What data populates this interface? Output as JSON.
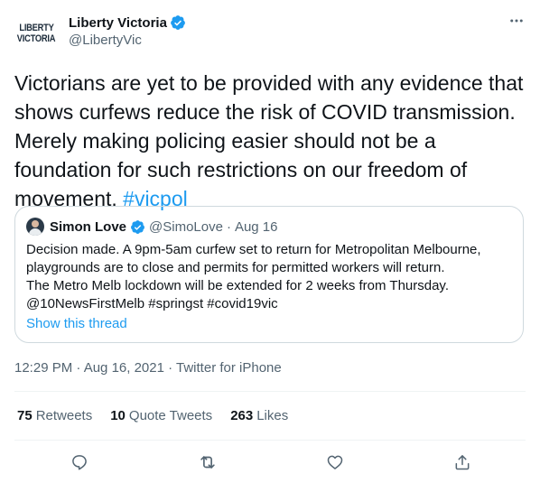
{
  "author": {
    "avatar_text_line1": "LIBERTY",
    "avatar_text_line2": "VICTORIA",
    "name": "Liberty Victoria",
    "handle": "@LibertyVic"
  },
  "tweet": {
    "text_part": "Victorians are yet to be provided with any evidence that shows curfews reduce the risk of COVID transmission. Merely making policing easier should not be a foundation for such restrictions on our freedom of movement.",
    "hashtag": "#vicpol",
    "meta": "12:29 PM · Aug 16, 2021 · Twitter for iPhone"
  },
  "quote": {
    "name": "Simon Love",
    "handle": "@SimoLove",
    "dot": "·",
    "date": "Aug 16",
    "line1": "Decision made. A 9pm-5am curfew set to return for Metropolitan Melbourne,",
    "line2": "playgrounds are to close and permits for permitted workers will return.",
    "line3": "The Metro Melb lockdown will be extended for 2 weeks from Thursday.",
    "line4": "@10NewsFirstMelb #springst #covid19vic",
    "show_thread": "Show this thread"
  },
  "stats": {
    "retweets_count": "75",
    "retweets_label": "Retweets",
    "quotes_count": "10",
    "quotes_label": "Quote Tweets",
    "likes_count": "263",
    "likes_label": "Likes"
  },
  "colors": {
    "accent": "#1d9bf0",
    "secondary_text": "#536471",
    "border": "#cfd9de"
  }
}
